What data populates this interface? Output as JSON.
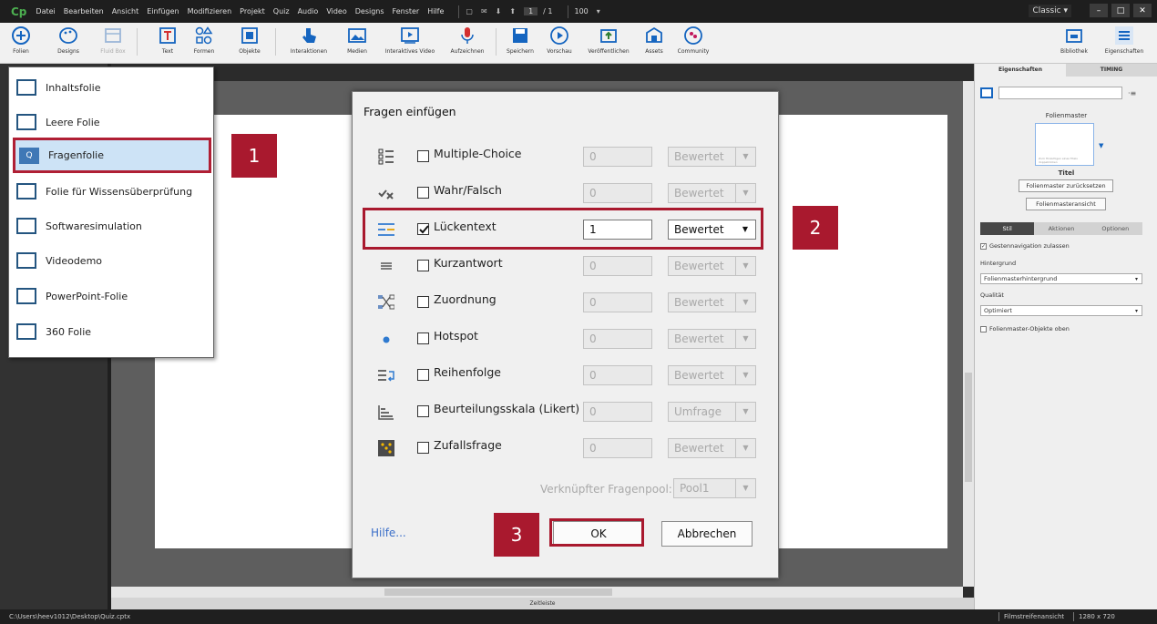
{
  "app": {
    "logo": "Cp",
    "menu": [
      "Datei",
      "Bearbeiten",
      "Ansicht",
      "Einfügen",
      "Modifizieren",
      "Projekt",
      "Quiz",
      "Audio",
      "Video",
      "Designs",
      "Fenster",
      "Hilfe"
    ],
    "page_current": "1",
    "page_total": "/ 1",
    "zoom": "100",
    "workspace": "Classic"
  },
  "toolbar": {
    "folien": "Folien",
    "designs": "Designs",
    "fluid_box": "Fluid Box",
    "text": "Text",
    "formen": "Formen",
    "objekte": "Objekte",
    "interaktionen": "Interaktionen",
    "medien": "Medien",
    "interaktives_video": "Interaktives Video",
    "aufzeichnen": "Aufzeichnen",
    "speichern": "Speichern",
    "vorschau": "Vorschau",
    "veroeffentlichen": "Veröffentlichen",
    "assets": "Assets",
    "community": "Community",
    "bibliothek": "Bibliothek",
    "eigenschaften": "Eigenschaften"
  },
  "folien_menu": {
    "items": [
      {
        "label": "Inhaltsfolie"
      },
      {
        "label": "Leere Folie"
      },
      {
        "label": "Fragenfolie",
        "selected": true
      },
      {
        "label": "Folie für Wissensüberprüfung"
      },
      {
        "label": "Softwaresimulation"
      },
      {
        "label": "Videodemo"
      },
      {
        "label": "PowerPoint-Folie"
      },
      {
        "label": "360 Folie"
      }
    ]
  },
  "dialog": {
    "title": "Fragen einfügen",
    "rows": [
      {
        "label": "Multiple-Choice",
        "checked": false,
        "count": "0",
        "type": "Bewertet"
      },
      {
        "label": "Wahr/Falsch",
        "checked": false,
        "count": "0",
        "type": "Bewertet"
      },
      {
        "label": "Lückentext",
        "checked": true,
        "count": "1",
        "type": "Bewertet"
      },
      {
        "label": "Kurzantwort",
        "checked": false,
        "count": "0",
        "type": "Bewertet"
      },
      {
        "label": "Zuordnung",
        "checked": false,
        "count": "0",
        "type": "Bewertet"
      },
      {
        "label": "Hotspot",
        "checked": false,
        "count": "0",
        "type": "Bewertet"
      },
      {
        "label": "Reihenfolge",
        "checked": false,
        "count": "0",
        "type": "Bewertet"
      },
      {
        "label": "Beurteilungsskala (Likert)",
        "checked": false,
        "count": "0",
        "type": "Umfrage"
      },
      {
        "label": "Zufallsfrage",
        "checked": false,
        "count": "0",
        "type": "Bewertet"
      }
    ],
    "pool_label": "Verknüpfter Fragenpool:",
    "pool_value": "Pool1",
    "help": "Hilfe...",
    "ok": "OK",
    "cancel": "Abbrechen"
  },
  "callouts": {
    "one": "1",
    "two": "2",
    "three": "3"
  },
  "properties": {
    "tab_props": "Eigenschaften",
    "tab_timing": "TIMING",
    "master_label": "Folienmaster",
    "thumb_text": "Zum Hinzufügen eines Titels doppelklicken",
    "master_title": "Titel",
    "reset_btn": "Folienmaster zurücksetzen",
    "view_btn": "Folienmasteransicht",
    "seg_style": "Stil",
    "seg_actions": "Aktionen",
    "seg_options": "Optionen",
    "gesture_label": "Gestennavigation zulassen",
    "background_label": "Hintergrund",
    "background_value": "Folienmasterhintergrund",
    "quality_label": "Qualität",
    "quality_value": "Optimiert",
    "master_objects_label": "Folienmaster-Objekte oben"
  },
  "timeline_label": "Zeitleiste",
  "status": {
    "path": "C:\\Users\\heev1012\\Desktop\\Quiz.cptx",
    "view": "Filmstreifenansicht",
    "size": "1280 x 720"
  },
  "colors": {
    "callout": "#a9192e",
    "selection": "#cde3f6",
    "accent": "#1565c0"
  }
}
